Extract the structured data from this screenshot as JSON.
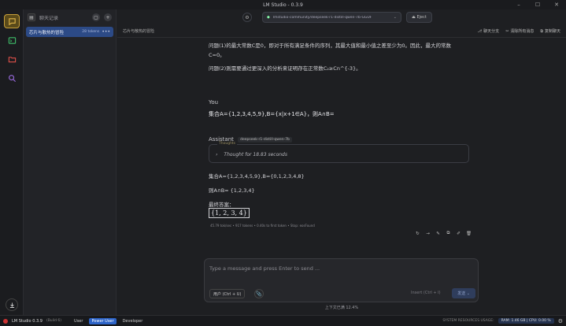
{
  "window": {
    "title": "LM Studio - 0.3.9"
  },
  "sidebar": {
    "header_label": "聊天记录",
    "items": [
      {
        "name": "芯片与散热的冒险",
        "tokens": "28 tokens"
      }
    ]
  },
  "topbar": {
    "model": "lmstudio-community/deepseek-r1-distill-qwen-7b-GGUF",
    "eject_label": "Eject"
  },
  "subbar": {
    "chat_title": "芯片与散热的冒险",
    "actions": [
      "聊天分支",
      "清除所有消息",
      "复制聊天"
    ]
  },
  "messages": {
    "prev_line1": "问题(1)的最大常数C是0，即对于所有满足条件的序列，其最大值和最小值之差至少为0。因此，最大的常数",
    "prev_line2": "C=0。",
    "prev_line3": "问题(2)则需要通过更深入的分析来证明存在正常数C₂≥Cn^{-3}。",
    "user_role": "You",
    "user_text": "集合A={1,2,3,4,5,9},B={x|x+1∈A}，则A∩B=",
    "assistant_role": "Assistant",
    "assistant_model": "deepseek-r1-distill-qwen-7b",
    "thoughts_label": "Thoughts",
    "thought_text": "Thought for 18.83 seconds",
    "answer_line1": "集合A={1,2,3,4,5,9},B={0,1,2,3,4,8}",
    "answer_line2": "则A∩B= {1,2,3,4}",
    "final_label": "最终答案：",
    "final_answer": "{1, 2, 3, 4}",
    "stats": "45.79 tok/sec • 917 tokens • 0.40s to first token • Stop: eosFound"
  },
  "composer": {
    "placeholder": "Type a message and press Enter to send ...",
    "role_button": "用户 (Ctrl + U)",
    "insert_label": "Insert (Ctrl + I)",
    "send_label": "发送"
  },
  "context_usage": "上下文已满 12.4%",
  "status": {
    "brand": "LM Studio 0.3.9",
    "build": "(Build 6)",
    "modes": [
      "User",
      "Power User",
      "Developer"
    ],
    "selected_mode": "Power User",
    "resources_label": "SYSTEM RESOURCES USAGE:",
    "ram": "RAM: 1.46 GB",
    "cpu": "CPU: 0.00 %"
  }
}
